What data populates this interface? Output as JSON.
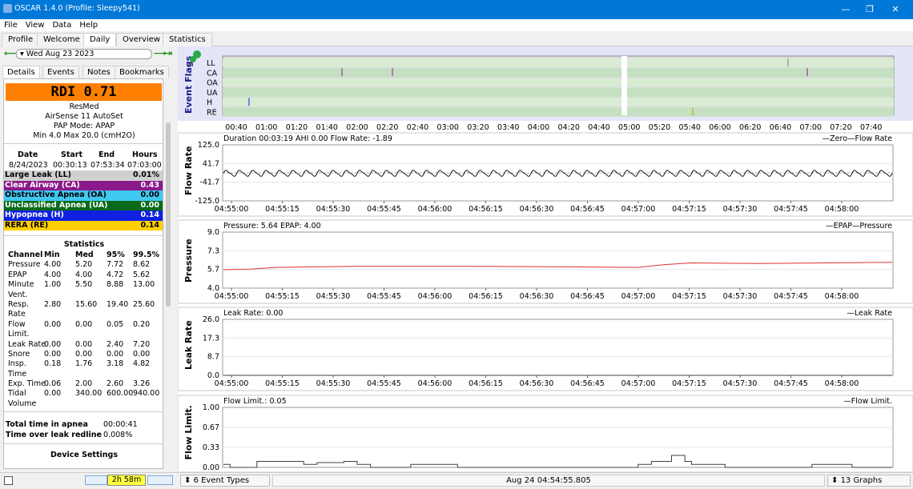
{
  "window": {
    "title": "OSCAR 1.4.0 (Profile: Sleepy541)",
    "minimize": "—",
    "restore": "❐",
    "close": "✕"
  },
  "menu": [
    "File",
    "View",
    "Data",
    "Help"
  ],
  "tabs": [
    "Profile",
    "Welcome",
    "Daily",
    "Overview",
    "Statistics"
  ],
  "active_tab": "Daily",
  "date_nav": {
    "prev": "⟵",
    "date": "Wed Aug 23 2023",
    "next": "⟶",
    "last": "⇥"
  },
  "subtabs": [
    "Details",
    "Events",
    "Notes",
    "Bookmarks"
  ],
  "details": {
    "rdi": "RDI 0.71",
    "device_brand": "ResMed",
    "device_model": "AirSense 11 AutoSet",
    "pap_mode": "PAP Mode: APAP",
    "pressure_range": "Min 4.0 Max 20.0 (cmH2O)",
    "session_headers": [
      "Date",
      "Start",
      "End",
      "Hours"
    ],
    "session": [
      "8/24/2023",
      "00:30:13",
      "07:53:34",
      "07:03:00"
    ],
    "events": [
      {
        "name": "Large Leak (LL)",
        "value": "0.01%",
        "color": "#d0d0d0",
        "text": "#000000"
      },
      {
        "name": "Clear Airway (CA)",
        "value": "0.43",
        "color": "#8a1a8a",
        "text": "#ffffff"
      },
      {
        "name": "Obstructive Apnea (OA)",
        "value": "0.00",
        "color": "#40c8f0",
        "text": "#000000"
      },
      {
        "name": "Unclassified Apnea (UA)",
        "value": "0.00",
        "color": "#0a6a1a",
        "text": "#ffffff"
      },
      {
        "name": "Hypopnea (H)",
        "value": "0.14",
        "color": "#1020e0",
        "text": "#ffffff"
      },
      {
        "name": "RERA (RE)",
        "value": "0.14",
        "color": "#ffd000",
        "text": "#000000"
      }
    ],
    "statistics_title": "Statistics",
    "stat_headers": [
      "Channel",
      "Min",
      "Med",
      "95%",
      "99.5%"
    ],
    "stats": [
      [
        "Pressure",
        "4.00",
        "5.20",
        "7.72",
        "8.62"
      ],
      [
        "EPAP",
        "4.00",
        "4.00",
        "4.72",
        "5.62"
      ],
      [
        "Minute",
        "1.00",
        "5.50",
        "8.88",
        "13.00"
      ],
      [
        "Vent.",
        "",
        "",
        "",
        ""
      ],
      [
        "Resp.",
        "2.80",
        "15.60",
        "19.40",
        "25.60"
      ],
      [
        "Rate",
        "",
        "",
        "",
        ""
      ],
      [
        "Flow",
        "0.00",
        "0.00",
        "0.05",
        "0.20"
      ],
      [
        "Limit.",
        "",
        "",
        "",
        ""
      ],
      [
        "Leak Rate",
        "0.00",
        "0.00",
        "2.40",
        "7.20"
      ],
      [
        "Snore",
        "0.00",
        "0.00",
        "0.00",
        "0.00"
      ],
      [
        "Insp.",
        "0.18",
        "1.76",
        "3.18",
        "4.82"
      ],
      [
        "Time",
        "",
        "",
        "",
        ""
      ],
      [
        "Exp. Time",
        "0.06",
        "2.00",
        "2.60",
        "3.26"
      ],
      [
        "Tidal",
        "0.00",
        "340.00",
        "600.00",
        "940.00"
      ],
      [
        "Volume",
        "",
        "",
        "",
        ""
      ]
    ],
    "total_apnea_label": "Total time in apnea",
    "total_apnea_value": "00:00:41",
    "leak_redline_label": "Time over leak redline",
    "leak_redline_value": "0.008%",
    "device_settings": "Device Settings"
  },
  "bottom": {
    "duration": "2h 58m",
    "event_types": "6 Event Types",
    "timestamp": "Aug 24 04:54:55.805",
    "graphs": "13 Graphs"
  },
  "event_flags": {
    "ylabel": "Event Flags",
    "rows": [
      "LL",
      "CA",
      "OA",
      "UA",
      "H",
      "RE"
    ],
    "ticks": [
      "00:40",
      "01:00",
      "01:20",
      "01:40",
      "02:00",
      "02:20",
      "02:40",
      "03:00",
      "03:20",
      "03:40",
      "04:00",
      "04:20",
      "04:40",
      "05:00",
      "05:20",
      "05:40",
      "06:00",
      "06:20",
      "06:40",
      "07:00",
      "07:20",
      "07:40"
    ]
  },
  "time_ticks": [
    "04:55:00",
    "04:55:15",
    "04:55:30",
    "04:55:45",
    "04:56:00",
    "04:56:15",
    "04:56:30",
    "04:56:45",
    "04:57:00",
    "04:57:15",
    "04:57:30",
    "04:57:45",
    "04:58:00"
  ],
  "chart_data": [
    {
      "type": "line",
      "title": "Flow Rate",
      "header": "Duration 00:03:19 AHI 0.00 Flow Rate: -1.89",
      "legend": [
        "Zero",
        "Flow Rate"
      ],
      "ylabel": "Flow Rate",
      "yticks": [
        "125.0",
        "41.7",
        "-41.7",
        "-125.0"
      ],
      "ylim": [
        -125,
        125
      ],
      "breath_cycles": 50,
      "amplitude": 15,
      "series_color": "#000000"
    },
    {
      "type": "line",
      "title": "Pressure",
      "header": "Pressure: 5.64 EPAP: 4.00",
      "legend": [
        "EPAP",
        "Pressure"
      ],
      "ylabel": "Pressure",
      "yticks": [
        "9.0",
        "7.3",
        "5.7",
        "4.0"
      ],
      "ylim": [
        4,
        9
      ],
      "series": [
        {
          "name": "Pressure",
          "x_frac": [
            0,
            0.04,
            0.08,
            0.2,
            0.35,
            0.5,
            0.62,
            0.66,
            0.7,
            0.8,
            0.9,
            1.0
          ],
          "values": [
            5.64,
            5.7,
            5.85,
            5.95,
            5.95,
            5.9,
            5.85,
            6.1,
            6.25,
            6.2,
            6.25,
            6.3
          ],
          "color": "#e03030"
        }
      ]
    },
    {
      "type": "line",
      "title": "Leak Rate",
      "header": "Leak Rate: 0.00",
      "legend": [
        "Leak Rate"
      ],
      "ylabel": "Leak Rate",
      "yticks": [
        "26.0",
        "17.3",
        "8.7",
        "0.0"
      ],
      "ylim": [
        0,
        26
      ],
      "series": [
        {
          "name": "Leak Rate",
          "values": [
            0,
            0
          ],
          "color": "#404040"
        }
      ]
    },
    {
      "type": "line",
      "title": "Flow Limit.",
      "header": "Flow Limit.: 0.05",
      "legend": [
        "Flow Limit."
      ],
      "ylabel": "Flow Limit.",
      "yticks": [
        "1.00",
        "0.67",
        "0.33",
        "0.00"
      ],
      "ylim": [
        0,
        1
      ],
      "series": [
        {
          "name": "Flow Limit.",
          "x_frac": [
            0,
            0.01,
            0.01,
            0.05,
            0.05,
            0.12,
            0.12,
            0.14,
            0.14,
            0.18,
            0.18,
            0.2,
            0.2,
            0.22,
            0.22,
            0.28,
            0.28,
            0.35,
            0.35,
            0.42,
            0.42,
            0.48,
            0.48,
            0.62,
            0.62,
            0.64,
            0.64,
            0.67,
            0.67,
            0.69,
            0.69,
            0.7,
            0.7,
            0.75,
            0.75,
            0.78,
            0.78,
            0.88,
            0.88,
            0.94,
            0.94,
            1.0
          ],
          "values": [
            0.05,
            0.05,
            0,
            0,
            0.1,
            0.1,
            0.05,
            0.05,
            0.08,
            0.08,
            0.1,
            0.1,
            0.05,
            0.05,
            0,
            0,
            0.05,
            0.05,
            0,
            0,
            0,
            0,
            0,
            0,
            0.05,
            0.05,
            0.1,
            0.1,
            0.2,
            0.2,
            0.1,
            0.1,
            0.05,
            0.05,
            0,
            0,
            0,
            0,
            0.05,
            0.05,
            0,
            0
          ],
          "color": "#404040"
        }
      ]
    }
  ]
}
